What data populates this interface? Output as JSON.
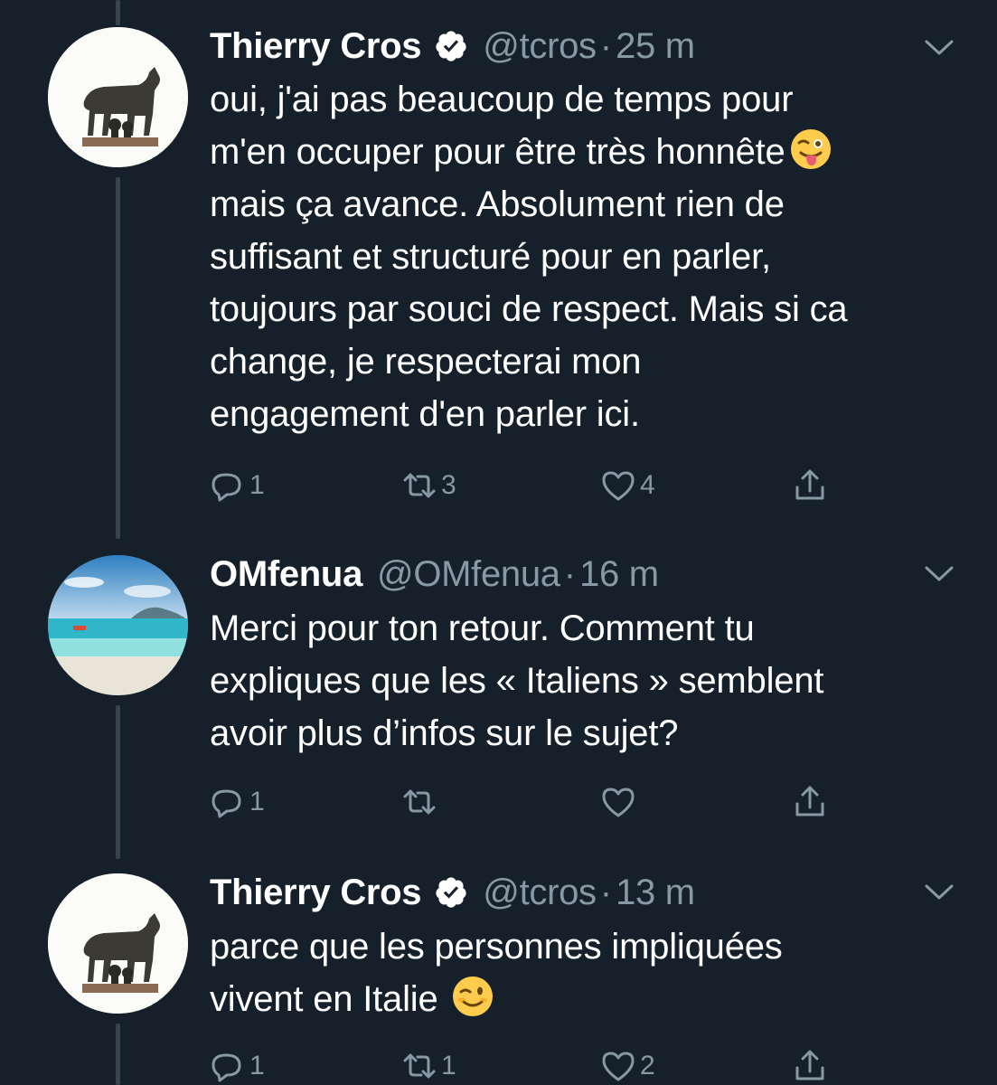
{
  "colors": {
    "background": "#15202b",
    "text_primary": "#ffffff",
    "text_secondary": "#8899a6",
    "verified_badge": "#ffffff",
    "thread_line": "#38444d"
  },
  "tweets": [
    {
      "name": "Thierry Cros",
      "verified": true,
      "handle": "@tcros",
      "separator": "·",
      "time": "25 m",
      "avatar": "she-wolf-statue-avatar",
      "lines": [
        "oui, j'ai pas beaucoup de temps pour",
        "m'en occuper pour être très honnête",
        "mais ça avance. Absolument rien de",
        "suffisant et structuré pour en parler,",
        "toujours par souci de respect. Mais si ca",
        "change, je respecterai mon",
        "engagement d'en parler ici."
      ],
      "emoji": "winking-face-with-tongue",
      "actions": {
        "replies": "1",
        "retweets": "3",
        "likes": "4"
      }
    },
    {
      "name": "OMfenua",
      "verified": false,
      "handle": "@OMfenua",
      "separator": "·",
      "time": "16 m",
      "avatar": "beach-lagoon-avatar",
      "lines": [
        "Merci pour ton retour. Comment tu",
        "expliques que les « Italiens » semblent",
        "avoir plus d’infos sur le sujet?"
      ],
      "actions": {
        "replies": "1",
        "retweets": "",
        "likes": ""
      }
    },
    {
      "name": "Thierry Cros",
      "verified": true,
      "handle": "@tcros",
      "separator": "·",
      "time": "13 m",
      "avatar": "she-wolf-statue-avatar",
      "lines": [
        "parce que les personnes impliquées",
        "vivent en Italie"
      ],
      "emoji": "winking-face",
      "actions": {
        "replies": "1",
        "retweets": "1",
        "likes": "2"
      }
    }
  ]
}
